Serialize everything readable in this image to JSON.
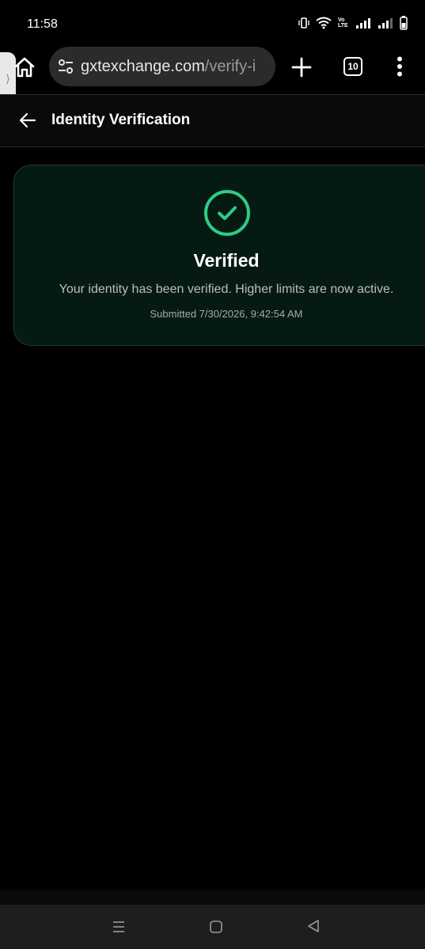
{
  "status_bar": {
    "time": "11:58",
    "icons": [
      "vibrate-icon",
      "wifi-icon",
      "volte-icon",
      "signal-icon",
      "signal-icon",
      "battery-icon"
    ],
    "volte_text": "Vo LTE"
  },
  "browser": {
    "url_domain": "gxtexchange.com",
    "url_path": "/verify-i",
    "tab_count": "10",
    "side_tab_glyph": "⟩"
  },
  "header": {
    "title": "Identity Verification"
  },
  "card": {
    "title": "Verified",
    "message": "Your identity has been verified. Higher limits are now active.",
    "submitted": "Submitted 7/30/2026, 9:42:54 AM"
  },
  "colors": {
    "accent": "#2ecc85",
    "card_bg": "#061a14",
    "card_border": "#1f3b31"
  }
}
